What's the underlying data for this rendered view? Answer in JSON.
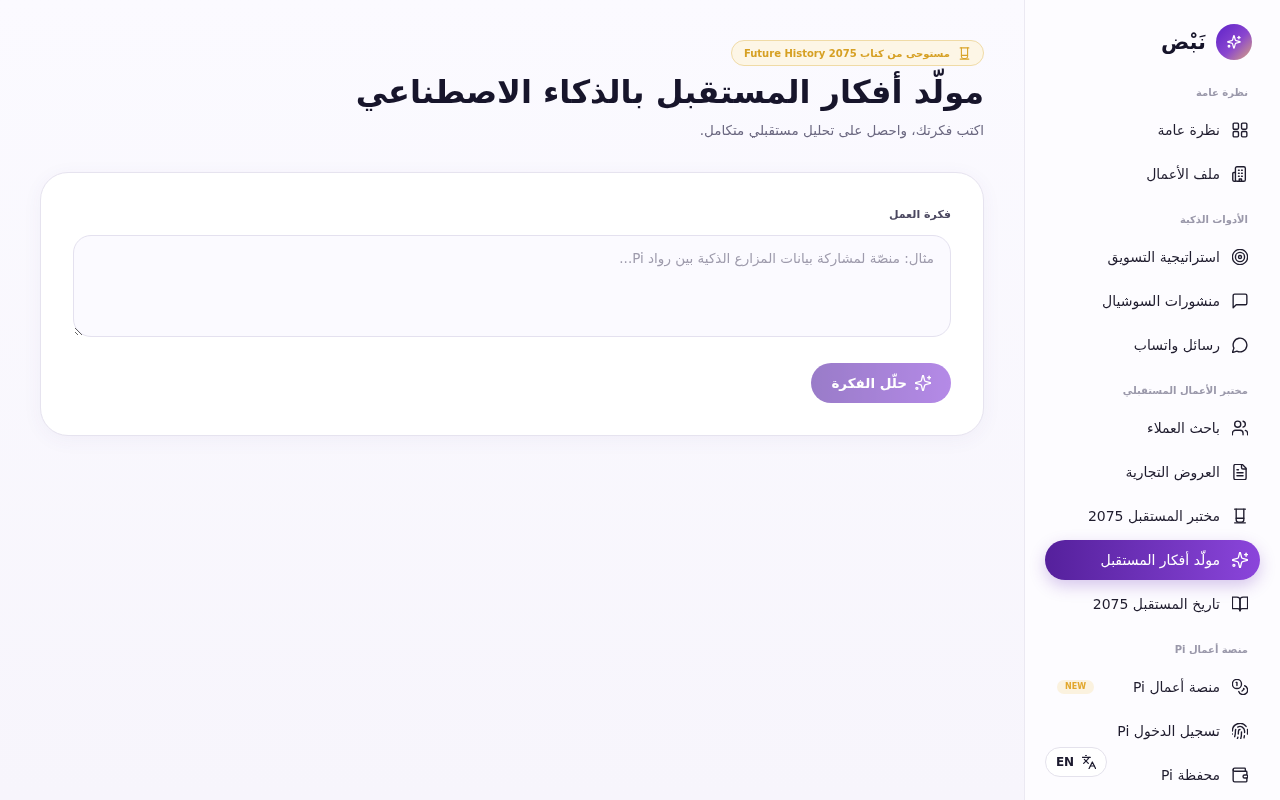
{
  "sidebar": {
    "brand": {
      "name": "نَبْض"
    },
    "sections": [
      {
        "heading": "نظرة عامة",
        "items": [
          {
            "label": "نظرة عامة",
            "selected": false
          },
          {
            "label": "ملف الأعمال",
            "selected": false
          }
        ]
      },
      {
        "heading": "الأدوات الذكية",
        "items": [
          {
            "label": "استراتيجية التسويق",
            "selected": false
          },
          {
            "label": "منشورات السوشيال",
            "selected": false
          },
          {
            "label": "رسائل واتساب",
            "selected": false
          }
        ]
      },
      {
        "heading": "مختبر الأعمال المستقبلي",
        "items": [
          {
            "label": "باحث العملاء",
            "selected": false
          },
          {
            "label": "العروض التجارية",
            "selected": false
          },
          {
            "label": "مختبر المستقبل 2075",
            "selected": false
          },
          {
            "label": "مولّد أفكار المستقبل",
            "selected": true
          },
          {
            "label": "تاريخ المستقبل 2075",
            "selected": false
          }
        ]
      },
      {
        "heading": "منصة أعمال Pi",
        "items": [
          {
            "label": "منصة أعمال Pi",
            "selected": false,
            "badge": "NEW"
          },
          {
            "label": "تسجيل الدخول Pi",
            "selected": false
          },
          {
            "label": "محفظة Pi",
            "selected": false
          }
        ]
      }
    ],
    "language_button": {
      "label": "EN"
    }
  },
  "main": {
    "badge": "مستوحى من كتاب Future History 2075",
    "title": "مولّد أفكار المستقبل بالذكاء الاصطناعي",
    "subtitle": "اكتب فكرتك، واحصل على تحليل مستقبلي متكامل.",
    "form": {
      "label": "فكرة العمل",
      "placeholder": "مثال: منصّة لمشاركة بيانات المزارع الذكية بين رواد Pi...",
      "submit": {
        "label": "حلّل الفكرة",
        "disabled": true
      }
    }
  }
}
